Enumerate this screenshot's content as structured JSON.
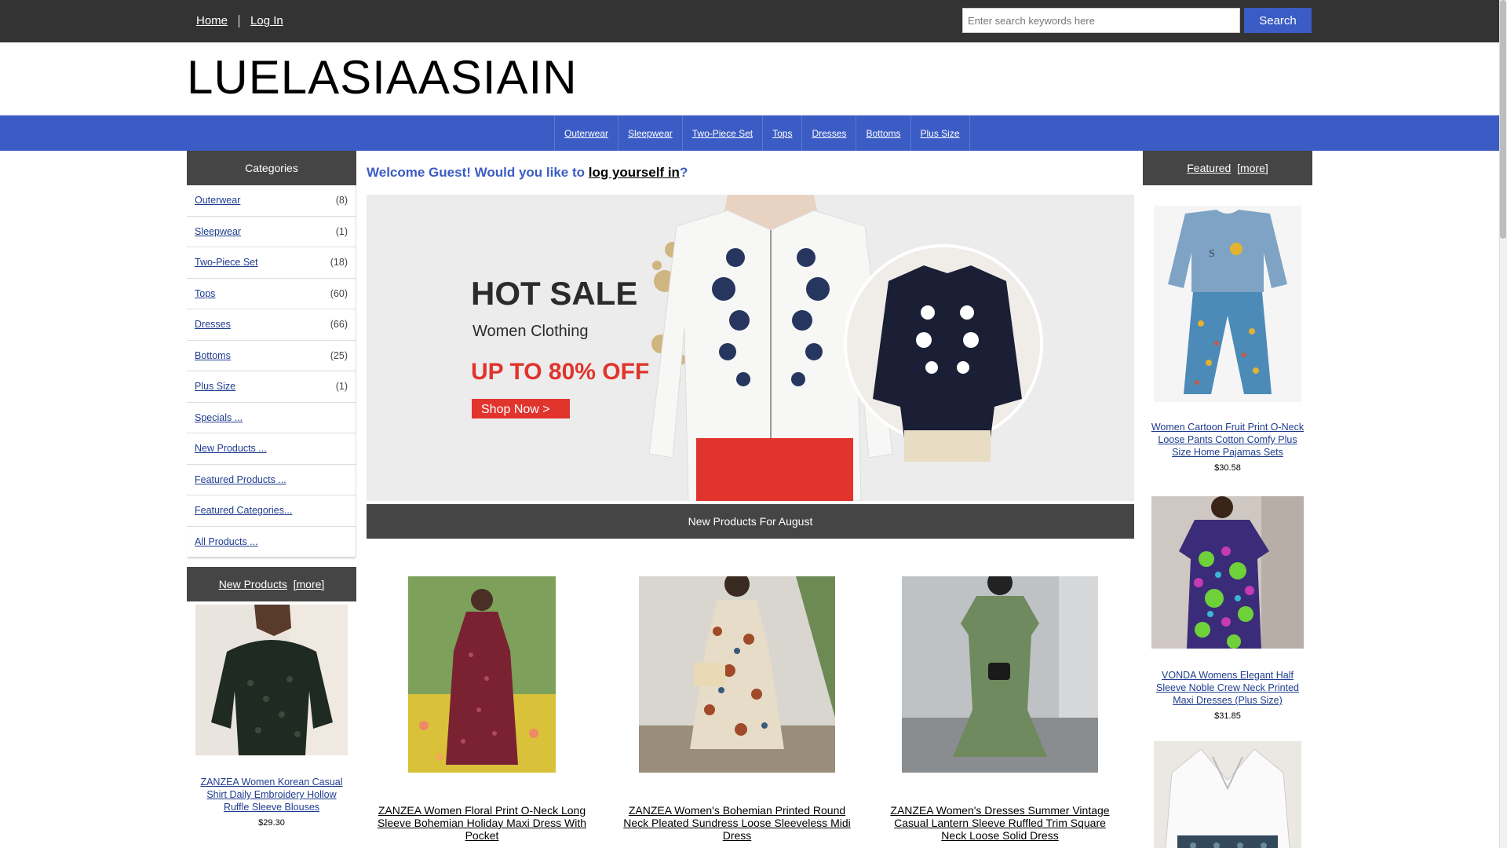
{
  "header": {
    "nav_home": "Home",
    "nav_login": "Log In",
    "search_placeholder": "Enter search keywords here",
    "search_button": "Search"
  },
  "logo": "LUELASIAASIAIN",
  "category_bar": [
    "Outerwear",
    "Sleepwear",
    "Two-Piece Set",
    "Tops",
    "Dresses",
    "Bottoms",
    "Plus Size"
  ],
  "sidebar": {
    "categories_title": "Categories",
    "categories": [
      {
        "label": "Outerwear",
        "count": "(8)"
      },
      {
        "label": "Sleepwear",
        "count": "(1)"
      },
      {
        "label": "Two-Piece Set",
        "count": "(18)"
      },
      {
        "label": "Tops",
        "count": "(60)"
      },
      {
        "label": "Dresses",
        "count": "(66)"
      },
      {
        "label": "Bottoms",
        "count": "(25)"
      },
      {
        "label": "Plus Size",
        "count": "(1)"
      }
    ],
    "links": [
      "Specials ...",
      "New Products ...",
      "Featured Products ...",
      "Featured Categories...",
      "All Products ..."
    ],
    "new_products_title": "New Products",
    "more_label": "[more]",
    "new_product": {
      "name": "ZANZEA Women Korean Casual Shirt Daily Embroidery Hollow Ruffle Sleeve Blouses",
      "price": "$29.30"
    }
  },
  "main": {
    "welcome_prefix": "Welcome Guest! Would you like to ",
    "welcome_link": "log yourself in",
    "welcome_suffix": "?",
    "banner": {
      "line1": "HOT SALE",
      "line2": "Women Clothing",
      "line3": "UP TO 80% OFF",
      "button": "Shop Now >"
    },
    "new_products_heading": "New Products For August",
    "products": [
      {
        "name": "ZANZEA Women Floral Print O-Neck Long Sleeve Bohemian Holiday Maxi Dress With Pocket"
      },
      {
        "name": "ZANZEA Women's Bohemian Printed Round Neck Pleated Sundress Loose Sleeveless Midi Dress"
      },
      {
        "name": "ZANZEA Women's Dresses Summer Vintage Casual Lantern Sleeve Ruffled Trim Square Neck Loose Solid Dress"
      }
    ]
  },
  "featured": {
    "title": "Featured",
    "more_label": "[more]",
    "items": [
      {
        "name": "Women Cartoon Fruit Print O-Neck Loose Pants Cotton Comfy Plus Size Home Pajamas Sets",
        "price": "$30.58"
      },
      {
        "name": "VONDA Womens Elegant Half Sleeve Noble Crew Neck Printed Maxi Dresses (Plus Size)",
        "price": "$31.85"
      }
    ]
  },
  "colors": {
    "topbar": "#333333",
    "accent": "#3b5cc4",
    "box_header": "#454545",
    "link": "#1f3c8f",
    "banner_red": "#e0342d"
  }
}
